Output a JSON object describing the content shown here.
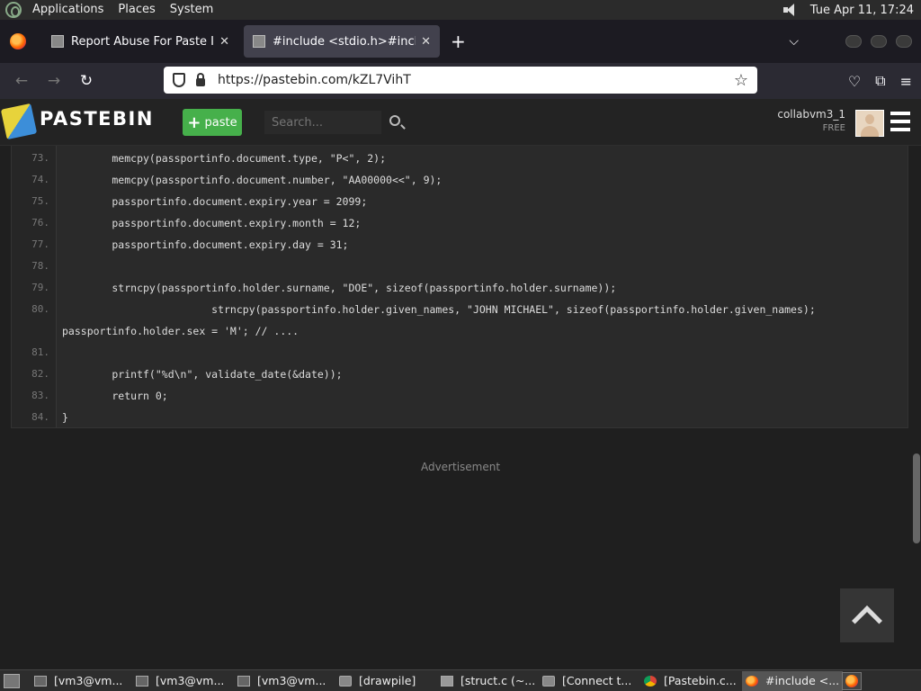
{
  "top_panel": {
    "menus": [
      "Applications",
      "Places",
      "System"
    ],
    "clock": "Tue Apr 11, 17:24"
  },
  "browser": {
    "tabs": [
      {
        "label": "Report Abuse For Paste ID:",
        "active": false
      },
      {
        "label": "#include <stdio.h>#include <",
        "active": true
      }
    ],
    "new_tab_label": "+",
    "url": "https://pastebin.com/kZL7VihT"
  },
  "pastebin": {
    "logo_text": "PASTEBIN",
    "paste_button": "paste",
    "search_placeholder": "Search...",
    "username": "collabvm3_1",
    "plan": "FREE",
    "ad_label": "Advertisement"
  },
  "code_lines": [
    {
      "no": "73.",
      "text": "        memcpy(passportinfo.document.type, \"P<\", 2);"
    },
    {
      "no": "74.",
      "text": "        memcpy(passportinfo.document.number, \"AA00000<<\", 9);"
    },
    {
      "no": "75.",
      "text": "        passportinfo.document.expiry.year = 2099;"
    },
    {
      "no": "76.",
      "text": "        passportinfo.document.expiry.month = 12;"
    },
    {
      "no": "77.",
      "text": "        passportinfo.document.expiry.day = 31;"
    },
    {
      "no": "78.",
      "text": ""
    },
    {
      "no": "79.",
      "text": "        strncpy(passportinfo.holder.surname, \"DOE\", sizeof(passportinfo.holder.surname));"
    },
    {
      "no": "80.",
      "text": "                        strncpy(passportinfo.holder.given_names, \"JOHN MICHAEL\", sizeof(passportinfo.holder.given_names);"
    },
    {
      "no": "",
      "text": "passportinfo.holder.sex = 'M'; // ...."
    },
    {
      "no": "81.",
      "text": ""
    },
    {
      "no": "82.",
      "text": "        printf(\"%d\\n\", validate_date(&date));"
    },
    {
      "no": "83.",
      "text": "        return 0;"
    },
    {
      "no": "84.",
      "text": "}"
    }
  ],
  "taskbar": {
    "items": [
      {
        "label": "[vm3@vm...",
        "icon": "terminal"
      },
      {
        "label": "[vm3@vm...",
        "icon": "terminal"
      },
      {
        "label": "[vm3@vm...",
        "icon": "terminal"
      },
      {
        "label": "[drawpile]",
        "icon": "folder"
      },
      {
        "label": "[struct.c (~...",
        "icon": "edit"
      },
      {
        "label": "[Connect t...",
        "icon": "folder"
      },
      {
        "label": "[Pastebin.c...",
        "icon": "chrome"
      },
      {
        "label": "#include <...",
        "icon": "ff"
      }
    ]
  }
}
